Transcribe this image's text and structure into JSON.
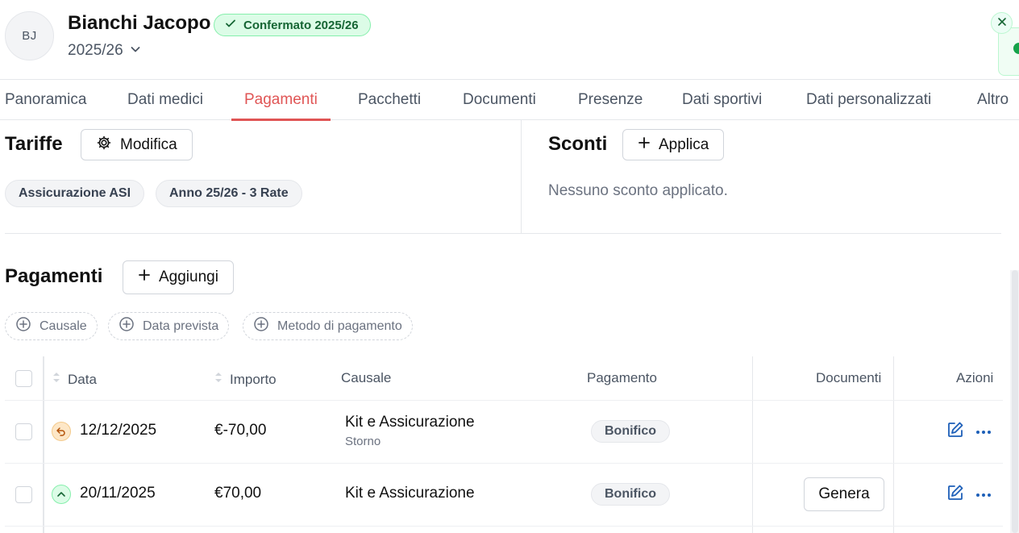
{
  "header": {
    "avatar_initials": "BJ",
    "name": "Bianchi Jacopo",
    "status_badge": "Confermato 2025/26",
    "season": "2025/26"
  },
  "tabs": [
    {
      "label": "Panoramica"
    },
    {
      "label": "Dati medici"
    },
    {
      "label": "Pagamenti",
      "active": true
    },
    {
      "label": "Pacchetti"
    },
    {
      "label": "Documenti"
    },
    {
      "label": "Presenze"
    },
    {
      "label": "Dati sportivi"
    },
    {
      "label": "Dati personalizzati"
    },
    {
      "label": "Altro"
    }
  ],
  "tariffe": {
    "title": "Tariffe",
    "edit_label": "Modifica",
    "chips": [
      "Assicurazione ASI",
      "Anno 25/26 - 3 Rate"
    ]
  },
  "sconti": {
    "title": "Sconti",
    "apply_label": "Applica",
    "empty_text": "Nessuno sconto applicato."
  },
  "pagamenti": {
    "title": "Pagamenti",
    "add_label": "Aggiungi",
    "filters": [
      "Causale",
      "Data prevista",
      "Metodo di pagamento"
    ],
    "columns": {
      "data": "Data",
      "importo": "Importo",
      "causale": "Causale",
      "pagamento": "Pagamento",
      "documenti": "Documenti",
      "azioni": "Azioni"
    },
    "rows": [
      {
        "date": "12/12/2025",
        "amount": "€-70,00",
        "causale": "Kit e Assicurazione",
        "causale_sub": "Storno",
        "pagamento": "Bonifico",
        "kind": "storno-icon"
      },
      {
        "date": "20/11/2025",
        "amount": "€70,00",
        "causale": "Kit e Assicurazione",
        "pagamento": "Bonifico",
        "documenti_action": "Genera",
        "kind": "paid-icon"
      }
    ]
  },
  "colors": {
    "accent": "#e05555",
    "success_bg": "#dcfce7",
    "success_text": "#166534",
    "action_blue": "#1d5fb8"
  }
}
